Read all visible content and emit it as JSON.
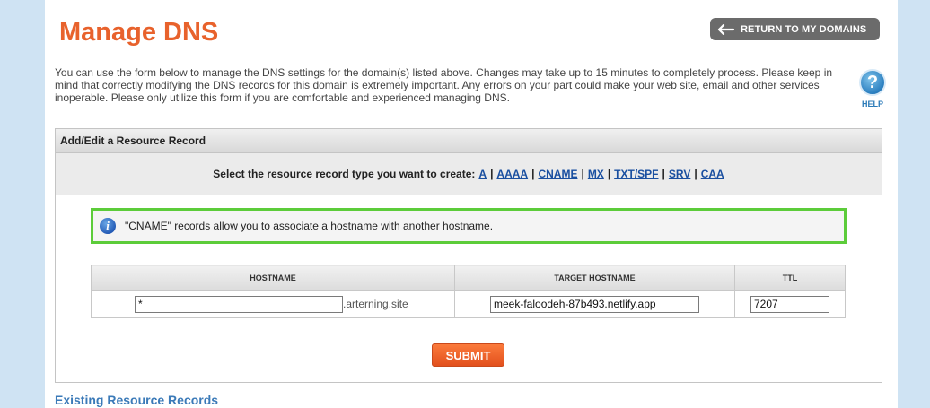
{
  "header": {
    "title": "Manage DNS",
    "return_button": "RETURN TO MY DOMAINS"
  },
  "intro": "You can use the form below to manage the DNS settings for the domain(s) listed above. Changes may take up to 15 minutes to completely process. Please keep in mind that correctly modifying the DNS records for this domain is extremely important. Any errors on your part could make your web site, email and other services inoperable. Please only utilize this form if you are comfortable and experienced managing DNS.",
  "help": {
    "icon": "question-icon",
    "glyph": "?",
    "label": "HELP"
  },
  "panel": {
    "title": "Add/Edit a Resource Record",
    "type_prompt": "Select the resource record type you want to create:",
    "types": [
      "A",
      "AAAA",
      "CNAME",
      "MX",
      "TXT/SPF",
      "SRV",
      "CAA"
    ],
    "info_icon": "info-icon",
    "info_glyph": "i",
    "info_text": "\"CNAME\" records allow you to associate a hostname with another hostname."
  },
  "table": {
    "headers": {
      "hostname": "HOSTNAME",
      "target": "TARGET HOSTNAME",
      "ttl": "TTL"
    },
    "row": {
      "hostname": "*",
      "suffix": ".arterning.site",
      "target": "meek-faloodeh-87b493.netlify.app",
      "ttl": "7207"
    }
  },
  "submit_label": "SUBMIT",
  "existing_label": "Existing Resource Records",
  "colors": {
    "title": "#e8622c",
    "link": "#1a4fa0",
    "info_border": "#5ccc3a",
    "submit": "#e2501d",
    "background": "#cfe3f3"
  }
}
